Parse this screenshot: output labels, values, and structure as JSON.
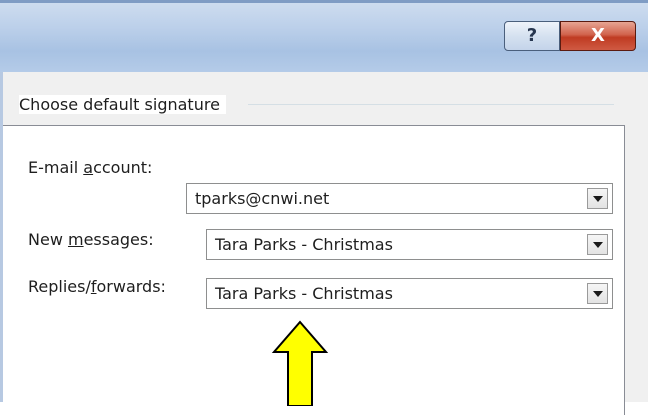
{
  "titlebar": {
    "help_label": "?",
    "close_label": "X"
  },
  "signature_group": {
    "title": "Choose default signature",
    "email_account": {
      "label_pre": "E-mail ",
      "label_accel": "a",
      "label_post": "ccount:",
      "value": "tparks@cnwi.net"
    },
    "new_messages": {
      "label_pre": "New ",
      "label_accel": "m",
      "label_post": "essages:",
      "value": "Tara Parks - Christmas"
    },
    "replies_forwards": {
      "label_pre": "Replies/",
      "label_accel": "f",
      "label_post": "orwards:",
      "value": "Tara Parks - Christmas"
    }
  },
  "colors": {
    "arrow_fill": "#ffff00",
    "arrow_stroke": "#000000",
    "close_button": "#c4432b"
  },
  "icons": [
    "help-icon",
    "close-icon",
    "dropdown-arrow-icon",
    "up-arrow-icon"
  ]
}
